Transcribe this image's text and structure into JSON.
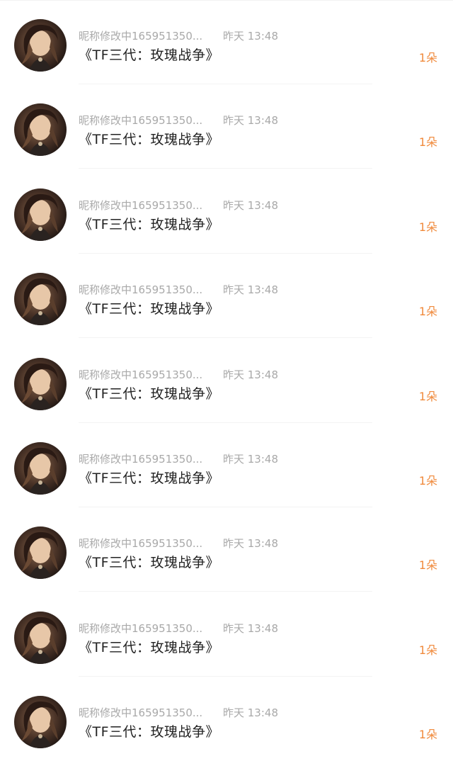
{
  "list": [
    {
      "nickname": "昵称修改中165951350...",
      "time": "昨天 13:48",
      "title": "《TF三代：玫瑰战争》",
      "count": "1朵"
    },
    {
      "nickname": "昵称修改中165951350...",
      "time": "昨天 13:48",
      "title": "《TF三代：玫瑰战争》",
      "count": "1朵"
    },
    {
      "nickname": "昵称修改中165951350...",
      "time": "昨天 13:48",
      "title": "《TF三代：玫瑰战争》",
      "count": "1朵"
    },
    {
      "nickname": "昵称修改中165951350...",
      "time": "昨天 13:48",
      "title": "《TF三代：玫瑰战争》",
      "count": "1朵"
    },
    {
      "nickname": "昵称修改中165951350...",
      "time": "昨天 13:48",
      "title": "《TF三代：玫瑰战争》",
      "count": "1朵"
    },
    {
      "nickname": "昵称修改中165951350...",
      "time": "昨天 13:48",
      "title": "《TF三代：玫瑰战争》",
      "count": "1朵"
    },
    {
      "nickname": "昵称修改中165951350...",
      "time": "昨天 13:48",
      "title": "《TF三代：玫瑰战争》",
      "count": "1朵"
    },
    {
      "nickname": "昵称修改中165951350...",
      "time": "昨天 13:48",
      "title": "《TF三代：玫瑰战争》",
      "count": "1朵"
    },
    {
      "nickname": "昵称修改中165951350...",
      "time": "昨天 13:48",
      "title": "《TF三代：玫瑰战争》",
      "count": "1朵"
    }
  ],
  "colors": {
    "accent": "#f08a3c",
    "meta_text": "#a9a9a9",
    "title_text": "#222222"
  },
  "icons": {
    "avatar": "avatar-image"
  }
}
